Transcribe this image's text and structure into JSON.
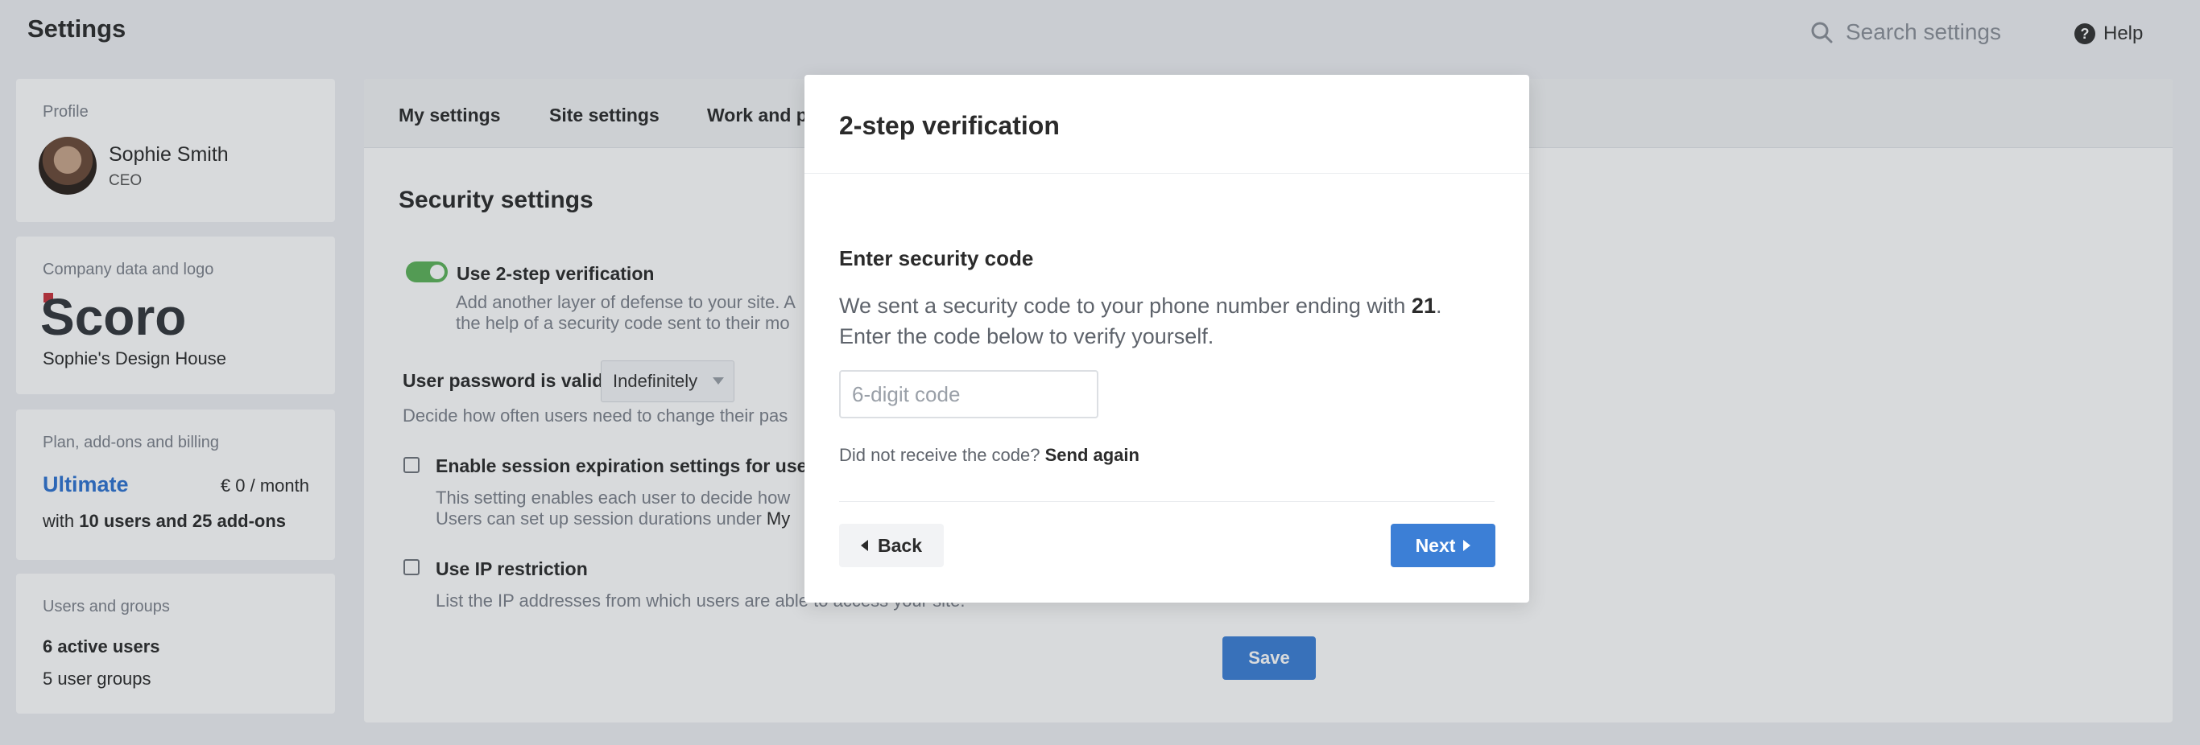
{
  "app": {
    "title": "Settings"
  },
  "search": {
    "placeholder": "Search settings",
    "icon": "search-icon"
  },
  "help": {
    "label": "Help",
    "icon": "help-icon"
  },
  "profile": {
    "section_label": "Profile",
    "name": "Sophie Smith",
    "role": "CEO"
  },
  "company": {
    "section_label": "Company data and logo",
    "logo_text": "Scoro",
    "name": "Sophie's Design House"
  },
  "plan": {
    "section_label": "Plan, add-ons and billing",
    "name": "Ultimate",
    "price": "€ 0 / month",
    "users_prefix": "with ",
    "users_text": "10 users and 25 add-ons"
  },
  "users_groups": {
    "section_label": "Users and groups",
    "active_users": "6 active users",
    "user_groups": "5 user groups"
  },
  "tabs": [
    {
      "label": "My settings"
    },
    {
      "label": "Site settings"
    },
    {
      "label": "Work and pr"
    }
  ],
  "security": {
    "title": "Security settings",
    "two_step": {
      "label": "Use 2-step verification",
      "desc_line1": "Add another layer of defense to your site. A",
      "desc_line2": "the help of a security code sent to their mo"
    },
    "password": {
      "label": "User password is valid:",
      "value": "Indefinitely",
      "desc": "Decide how often users need to change their pas"
    },
    "session": {
      "label": "Enable session expiration settings for users",
      "desc_line1": "This setting enables each user to decide how",
      "desc_line2_prefix": "Users can set up session durations under ",
      "desc_line2_link": "My"
    },
    "ip": {
      "label": "Use IP restriction",
      "desc": "List the IP addresses from which users are able to access your site."
    },
    "save_label": "Save"
  },
  "modal": {
    "title": "2-step verification",
    "subtitle": "Enter security code",
    "text_prefix": "We sent a security code to your phone number ending with ",
    "phone_suffix": "21",
    "text_suffix": ". Enter the code below to verify yourself.",
    "code_placeholder": "6-digit code",
    "resend_prefix": "Did not receive the code? ",
    "resend_link": "Send again",
    "back_label": "Back",
    "next_label": "Next"
  },
  "colors": {
    "accent": "#3c7fd6",
    "toggle_on": "#5db35a",
    "brand_red": "#c8323c"
  }
}
